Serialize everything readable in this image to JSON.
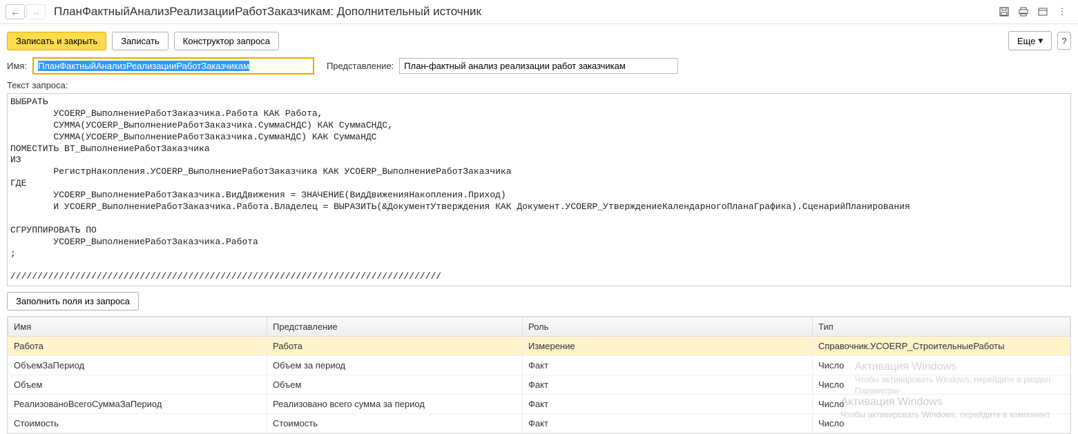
{
  "header": {
    "title": "ПланФактныйАнализРеализацииРаботЗаказчикам: Дополнительный источник"
  },
  "toolbar": {
    "save_close": "Записать и закрыть",
    "save": "Записать",
    "query_builder": "Конструктор запроса",
    "more": "Еще",
    "help": "?"
  },
  "form": {
    "name_label": "Имя:",
    "name_value": "ПланФактныйАнализРеализацииРаботЗаказчикам",
    "pres_label": "Представление:",
    "pres_value": "План-фактный анализ реализации работ заказчикам",
    "query_label": "Текст запроса:",
    "query_text": "ВЫБРАТЬ\n        УСОERP_ВыполнениеРаботЗаказчика.Работа КАК Работа,\n        СУММА(УСОERP_ВыполнениеРаботЗаказчика.СуммаСНДС) КАК СуммаСНДС,\n        СУММА(УСОERP_ВыполнениеРаботЗаказчика.СуммаНДС) КАК СуммаНДС\nПОМЕСТИТЬ ВТ_ВыполнениеРаботЗаказчика\nИЗ\n        РегистрНакопления.УСОERP_ВыполнениеРаботЗаказчика КАК УСОERP_ВыполнениеРаботЗаказчика\nГДЕ\n        УСОERP_ВыполнениеРаботЗаказчика.ВидДвижения = ЗНАЧЕНИЕ(ВидДвиженияНакопления.Приход)\n        И УСОERP_ВыполнениеРаботЗаказчика.Работа.Владелец = ВЫРАЗИТЬ(&ДокументУтверждения КАК Документ.УСОERP_УтверждениеКалендарногоПланаГрафика).СценарийПланирования\n\nСГРУППИРОВАТЬ ПО\n        УСОERP_ВыполнениеРаботЗаказчика.Работа\n;\n\n////////////////////////////////////////////////////////////////////////////////",
    "fill_fields": "Заполнить поля из запроса"
  },
  "table": {
    "headers": {
      "name": "Имя",
      "pres": "Представление",
      "role": "Роль",
      "type": "Тип"
    },
    "rows": [
      {
        "name": "Работа",
        "pres": "Работа",
        "role": "Измерение",
        "type": "Справочник.УСОERP_СтроительныеРаботы",
        "selected": true
      },
      {
        "name": "ОбъемЗаПериод",
        "pres": "Объем за период",
        "role": "Факт",
        "type": "Число"
      },
      {
        "name": "Объем",
        "pres": "Объем",
        "role": "Факт",
        "type": "Число"
      },
      {
        "name": "РеализованоВсегоСуммаЗаПериод",
        "pres": "Реализовано всего сумма за период",
        "role": "Факт",
        "type": "Число"
      },
      {
        "name": "Стоимость",
        "pres": "Стоимость",
        "role": "Факт",
        "type": "Число"
      }
    ]
  },
  "watermark": {
    "line1a": "Активация Windows",
    "line2a": "Чтобы активировать Windows, перейдите в раздел",
    "line3a": "Параметры .",
    "line1b": "Активация Windows",
    "line2b": "Чтобы активировать Windows, перейдите в компонент"
  }
}
